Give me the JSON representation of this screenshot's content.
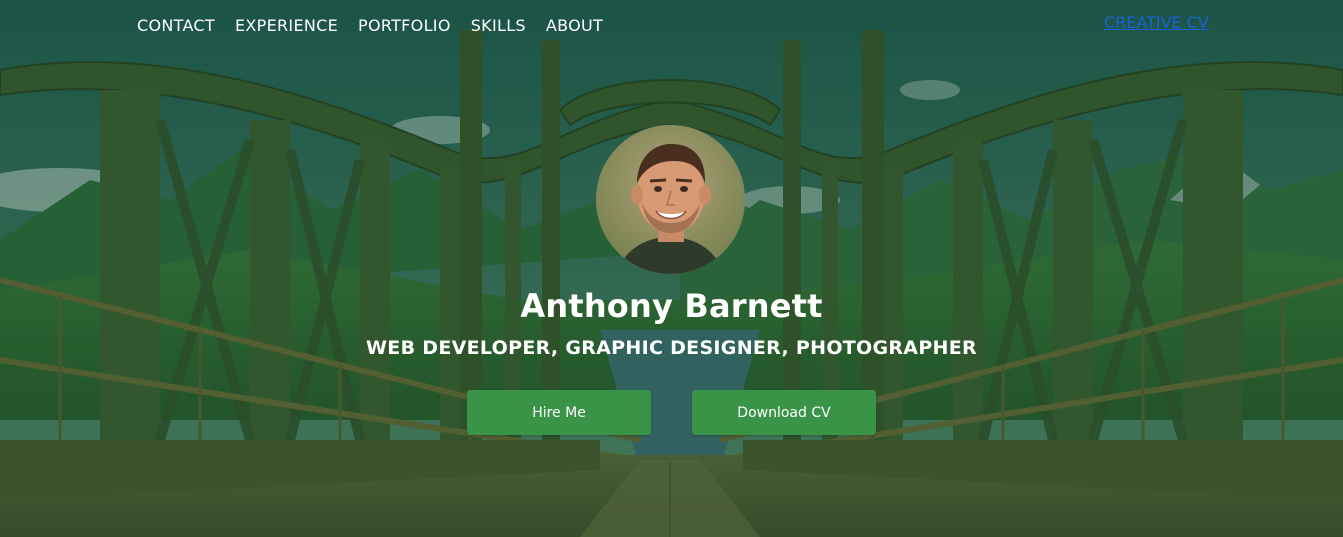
{
  "nav": {
    "items": [
      {
        "label": "CONTACT"
      },
      {
        "label": "EXPERIENCE"
      },
      {
        "label": "PORTFOLIO"
      },
      {
        "label": "SKILLS"
      },
      {
        "label": "ABOUT"
      }
    ]
  },
  "brand": {
    "label": "CREATIVE CV"
  },
  "hero": {
    "name": "Anthony Barnett",
    "tagline": "WEB DEVELOPER, GRAPHIC DESIGNER, PHOTOGRAPHER",
    "hire_label": "Hire Me",
    "download_label": "Download CV"
  },
  "colors": {
    "button_bg": "#3a9448",
    "brand_link": "#1a62d6",
    "overlay_tint": "#12462a"
  },
  "icons": {
    "avatar": "profile-photo"
  }
}
